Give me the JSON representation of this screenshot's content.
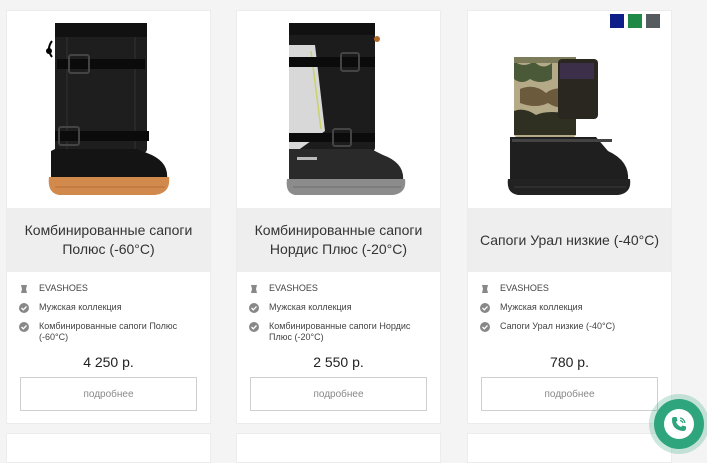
{
  "products": [
    {
      "title": "Комбинированные сапоги Полюс (-60°С)",
      "brand": "EVASHOES",
      "collection": "Мужская коллекция",
      "model": "Комбинированные сапоги Полюс (-60°С)",
      "price": "4 250 р.",
      "button": "подробнее",
      "sole_color": "#d2894c"
    },
    {
      "title": "Комбинированные сапоги Нордис Плюс (-20°С)",
      "brand": "EVASHOES",
      "collection": "Мужская коллекция",
      "model": "Комбинированные сапоги Нордис Плюс (-20°С)",
      "price": "2 550 р.",
      "button": "подробнее",
      "sole_color": "#8c8c8c"
    },
    {
      "title": "Сапоги Урал низкие (-40°С)",
      "brand": "EVASHOES",
      "collection": "Мужская коллекция",
      "model": "Сапоги Урал низкие (-40°С)",
      "price": "780 р.",
      "button": "подробнее",
      "sole_color": "#222222",
      "swatches": [
        "#0f1f8a",
        "#1f8a45",
        "#555b5e"
      ]
    }
  ],
  "icons": {
    "brand": "brand-tag-icon",
    "check": "check-circle-icon",
    "call": "phone-call-icon"
  }
}
